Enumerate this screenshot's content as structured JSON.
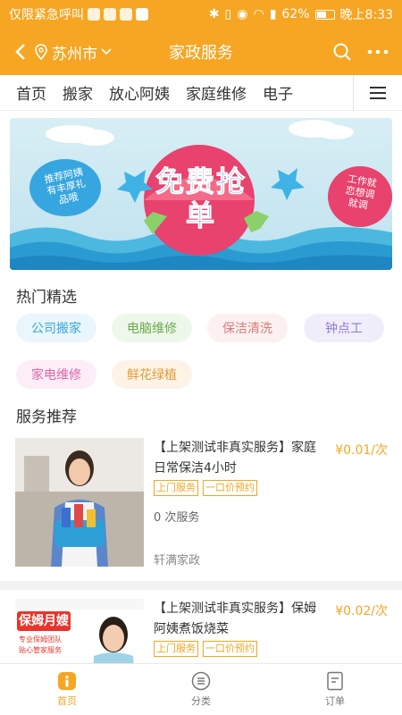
{
  "statusbar": {
    "left_text": "仅限紧急呼叫",
    "battery": "62%",
    "time": "晚上8:33",
    "battery_level": 0.62
  },
  "navbar": {
    "city": "苏州市",
    "title": "家政服务"
  },
  "tabs": [
    "首页",
    "搬家",
    "放心阿姨",
    "家庭维修",
    "电子"
  ],
  "banner": {
    "main_text": "免费抢单",
    "left_bubble": "推荐阿姨有丰厚礼品哦",
    "right_bubble": "工作就恋想调就调"
  },
  "hot": {
    "title": "热门精选",
    "chips": [
      "公司搬家",
      "电脑维修",
      "保洁清洗",
      "钟点工",
      "家电维修",
      "鲜花绿植"
    ]
  },
  "recommend": {
    "title": "服务推荐",
    "items": [
      {
        "title": "【上架测试非真实服务】家庭日常保洁4小时",
        "price": "¥0.01/次",
        "tags": [
          "上门服务",
          "一口价预约"
        ],
        "count": "0 次服务",
        "shop": "轩满家政"
      },
      {
        "title": "【上架测试非真实服务】保姆阿姨煮饭烧菜",
        "price": "¥0.02/次",
        "tags": [
          "上门服务",
          "一口价预约"
        ],
        "image_text": "保姆月嫂",
        "image_bullets": [
          "专业保姆团队",
          "贴心管家服务"
        ]
      }
    ]
  },
  "bottombar": {
    "items": [
      "首页",
      "分类",
      "订单"
    ]
  },
  "colors": {
    "accent": "#f6a623"
  }
}
